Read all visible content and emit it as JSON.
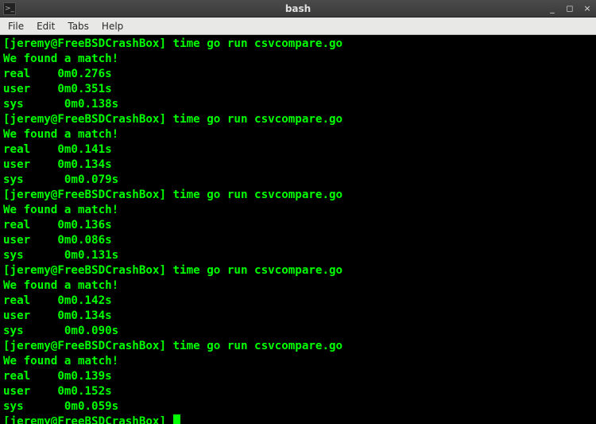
{
  "window": {
    "title": "bash",
    "iconGlyph": ">_",
    "controls": {
      "minimize": "_",
      "maximize": "◻",
      "close": "×"
    }
  },
  "menubar": {
    "items": [
      "File",
      "Edit",
      "Tabs",
      "Help"
    ]
  },
  "terminal": {
    "prompt": "[jeremy@FreeBSDCrashBox]",
    "command": "time go run csvcompare.go",
    "matchMsg": "We found a match!",
    "runs": [
      {
        "real": "0m0.276s",
        "user": "0m0.351s",
        "sys": "0m0.138s"
      },
      {
        "real": "0m0.141s",
        "user": "0m0.134s",
        "sys": "0m0.079s"
      },
      {
        "real": "0m0.136s",
        "user": "0m0.086s",
        "sys": "0m0.131s"
      },
      {
        "real": "0m0.142s",
        "user": "0m0.134s",
        "sys": "0m0.090s"
      },
      {
        "real": "0m0.139s",
        "user": "0m0.152s",
        "sys": "0m0.059s"
      }
    ],
    "labels": {
      "real": "real",
      "user": "user",
      "sys": "sys "
    }
  }
}
